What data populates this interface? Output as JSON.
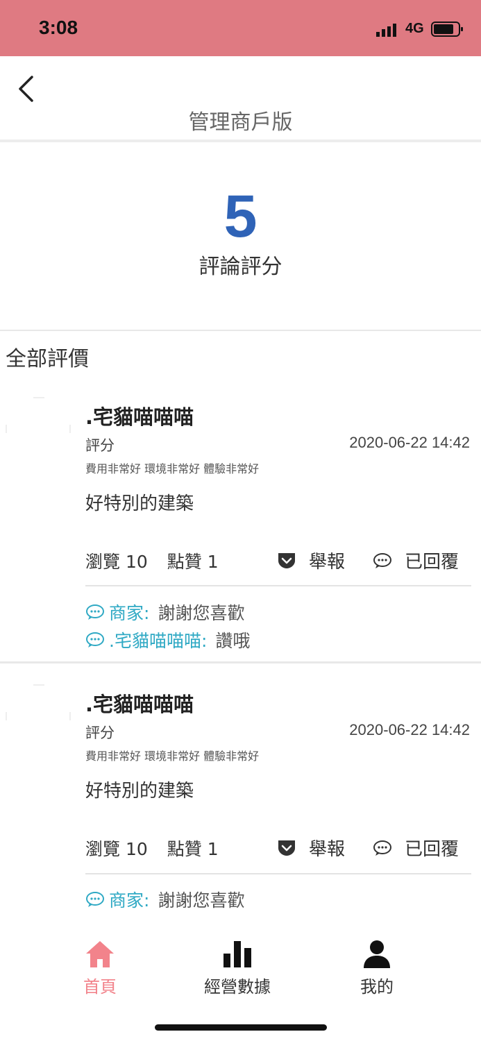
{
  "status": {
    "time": "3:08",
    "network": "4G"
  },
  "nav": {
    "title": "管理商戶版",
    "back_icon": "chevron-left-icon"
  },
  "score": {
    "value": "5",
    "label": "評論評分",
    "color": "#2f63b7"
  },
  "section_title": "全部評價",
  "reviews": [
    {
      "name": ".宅貓喵喵喵",
      "rating_label": "評分",
      "date": "2020-06-22 14:42",
      "tags": "費用非常好 環境非常好 體驗非常好",
      "content": "好特別的建築",
      "views": "瀏覽 10",
      "likes": "點贊 1",
      "report_label": "舉報",
      "reply_status": "已回覆",
      "replies": [
        {
          "who": "商家:",
          "message": "謝謝您喜歡"
        },
        {
          "who": ".宅貓喵喵喵:",
          "message": "讚哦"
        }
      ]
    },
    {
      "name": ".宅貓喵喵喵",
      "rating_label": "評分",
      "date": "2020-06-22 14:42",
      "tags": "費用非常好 環境非常好 體驗非常好",
      "content": "好特別的建築",
      "views": "瀏覽 10",
      "likes": "點贊 1",
      "report_label": "舉報",
      "reply_status": "已回覆",
      "replies": [
        {
          "who": "商家:",
          "message": "謝謝您喜歡"
        }
      ]
    }
  ],
  "tabbar": {
    "items": [
      {
        "label": "首頁",
        "icon": "home-icon",
        "active": true
      },
      {
        "label": "經營數據",
        "icon": "bar-chart-icon",
        "active": false
      },
      {
        "label": "我的",
        "icon": "user-icon",
        "active": false
      }
    ]
  },
  "colors": {
    "status_bar": "#df7a82",
    "accent": "#f2838b",
    "reply": "#2fa9c4"
  }
}
